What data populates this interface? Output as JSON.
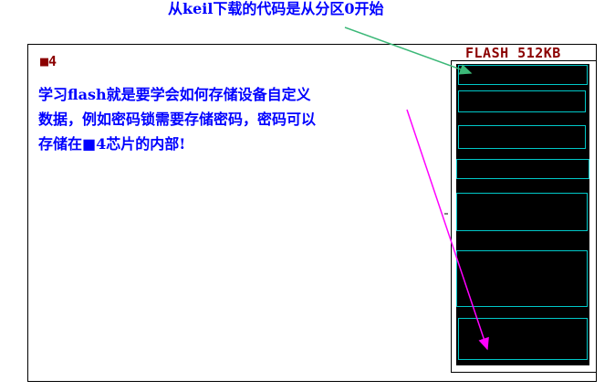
{
  "caption": "从keil下载的代码是从分区0开始",
  "chip": "■4",
  "description": "学习flash就是要学会如何存储设备自定义\n数据，例如密码锁需要存储密码，密码可以\n存储在■4芯片的内部!",
  "flash_title": "FLASH 512KB",
  "colors": {
    "text_blue": "#0000ff",
    "title_red": "#8b0000",
    "sector_border": "#00c8c8",
    "flash_fill": "#000000",
    "arrow_green": "#3cb878",
    "arrow_magenta": "#ff00ff"
  },
  "flash_sectors": 7,
  "arrows": [
    {
      "name": "caption-to-sector0-arrow",
      "color": "green"
    },
    {
      "name": "description-to-bottom-sector-arrow",
      "color": "magenta"
    }
  ]
}
